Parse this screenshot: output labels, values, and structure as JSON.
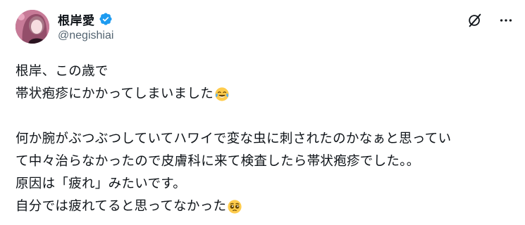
{
  "author": {
    "display_name": "根岸愛",
    "handle": "@negishiai",
    "verified": true
  },
  "actions": {
    "grok_icon": "grok-icon",
    "more_icon": "more-icon"
  },
  "tweet": {
    "lines": [
      "根岸、この歳で",
      "帯状疱疹にかかってしまいました",
      "",
      "何か腕がぶつぶつしていてハワイで変な虫に刺されたのかなぁと思ってい",
      "て中々治らなかったので皮膚科に来て検査したら帯状疱疹でした。。",
      "原因は「疲れ」みたいです。",
      "自分では疲れてると思ってなかった"
    ],
    "emoji": {
      "line2": "face-with-tears-of-joy",
      "line7": "pleading-face"
    }
  },
  "colors": {
    "text": "#0f1419",
    "secondary": "#536471",
    "verified": "#1d9bf0"
  }
}
